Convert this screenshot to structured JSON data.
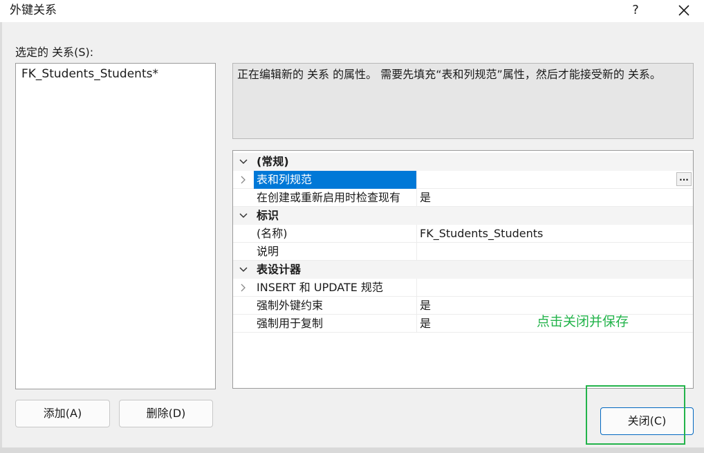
{
  "window": {
    "title": "外键关系",
    "help_label": "?"
  },
  "left_panel": {
    "label": "选定的 关系(S):",
    "relationships": [
      "FK_Students_Students*"
    ]
  },
  "description": "正在编辑新的 关系 的属性。 需要先填充“表和列规范”属性，然后才能接受新的 关系。",
  "properties": {
    "cat_general": "(常规)",
    "table_col_spec": "表和列规范",
    "check_existing_name": "在创建或重新启用时检查现有",
    "check_existing_value": "是",
    "cat_identity": "标识",
    "name_label": "(名称)",
    "name_value": "FK_Students_Students",
    "description_label": "说明",
    "description_value": "",
    "cat_designer": "表设计器",
    "insert_update_spec": "INSERT 和 UPDATE 规范",
    "enforce_fk_name": "强制外键约束",
    "enforce_fk_value": "是",
    "enforce_replication_name": "强制用于复制",
    "enforce_replication_value": "是",
    "ellipsis": "..."
  },
  "annotation": "点击关闭并保存",
  "buttons": {
    "add": "添加(A)",
    "delete": "删除(D)",
    "close": "关闭(C)"
  },
  "colors": {
    "selection": "#0078d7",
    "annotation_green": "#22b34a",
    "accent_border": "#0067c0"
  }
}
